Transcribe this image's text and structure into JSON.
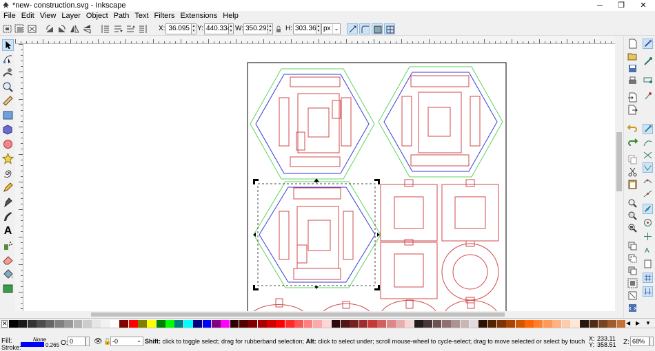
{
  "window": {
    "title": "*new- construction.svg - Inkscape",
    "controls": [
      "─",
      "❐",
      "✕"
    ]
  },
  "menu": [
    "File",
    "Edit",
    "View",
    "Layer",
    "Object",
    "Path",
    "Text",
    "Filters",
    "Extensions",
    "Help"
  ],
  "toolbar": {
    "x_label": "X:",
    "x_value": "36.095",
    "y_label": "Y:",
    "y_value": "440.334",
    "w_label": "W:",
    "w_value": "350.293",
    "h_label": "H:",
    "h_value": "303.362",
    "unit": "px"
  },
  "palette": {
    "colors": [
      "#000000",
      "#1a1a1a",
      "#333333",
      "#4d4d4d",
      "#666666",
      "#808080",
      "#999999",
      "#b3b3b3",
      "#cccccc",
      "#e6e6e6",
      "#f2f2f2",
      "#ffffff",
      "#800000",
      "#ff0000",
      "#808000",
      "#ffff00",
      "#008000",
      "#00ff00",
      "#008080",
      "#00ffff",
      "#000080",
      "#0000ff",
      "#800080",
      "#ff00ff",
      "#2b0000",
      "#550000",
      "#800000",
      "#aa0000",
      "#d40000",
      "#ff0000",
      "#ff2a2a",
      "#ff5555",
      "#ff8080",
      "#ffaaaa",
      "#ffd5d5",
      "#280b0b",
      "#501616",
      "#782121",
      "#a02c2c",
      "#c83737",
      "#d35f5f",
      "#de8787",
      "#e9afaf",
      "#f4d7d7",
      "#241c1c",
      "#483737",
      "#6c5353",
      "#916f6f",
      "#ac9393",
      "#c8b7b7",
      "#e3dbdb",
      "#2b1100",
      "#552200",
      "#803300",
      "#aa4400",
      "#d45500",
      "#ff6600",
      "#ff7f2a",
      "#ff9955",
      "#ffb380",
      "#ffccaa",
      "#ffe6d5",
      "#28170b",
      "#502d16",
      "#784421",
      "#a05a2c",
      "#c87137"
    ]
  },
  "status": {
    "fill_label": "Fill:",
    "fill_value": "None",
    "stroke_label": "Stroke:",
    "stroke_width": "0.265",
    "opacity_label": "O:",
    "opacity_value": "0",
    "layer_value": "-0",
    "message_bold1": "Shift:",
    "message1": " click to toggle select; drag for rubberband selection; ",
    "message_bold2": "Alt:",
    "message2": " click to select under; scroll mouse-wheel to cycle-select; drag to move selected or select by touch",
    "coord_x_label": "X:",
    "coord_x": "233.11",
    "coord_y_label": "Y:",
    "coord_y": "358.51",
    "zoom_label": "Z:",
    "zoom_value": "68%"
  },
  "icons": {
    "left_tools": [
      "selector-tool-icon",
      "node-tool-icon",
      "tweak-tool-icon",
      "zoom-tool-icon",
      "measure-tool-icon",
      "rect-tool-icon",
      "3dbox-tool-icon",
      "ellipse-tool-icon",
      "star-tool-icon",
      "spiral-tool-icon",
      "pencil-tool-icon",
      "pen-tool-icon",
      "calligraphy-tool-icon",
      "text-tool-icon",
      "spray-tool-icon",
      "eraser-tool-icon",
      "bucket-tool-icon",
      "gradient-tool-icon"
    ],
    "right_commands": [
      "new-doc-icon",
      "open-doc-icon",
      "save-doc-icon",
      "print-icon",
      "import-icon",
      "export-icon",
      "undo-icon",
      "redo-icon",
      "copy-icon",
      "cut-icon",
      "paste-icon",
      "zoom-selection-icon",
      "zoom-drawing-icon",
      "zoom-page-icon",
      "duplicate-icon",
      "clone-icon",
      "unlink-clone-icon",
      "group-icon",
      "ungroup-icon",
      "fill-stroke-icon",
      "text-font-icon",
      "layers-icon",
      "xml-editor-icon",
      "align-icon",
      "preferences-icon",
      "document-properties-icon"
    ]
  }
}
